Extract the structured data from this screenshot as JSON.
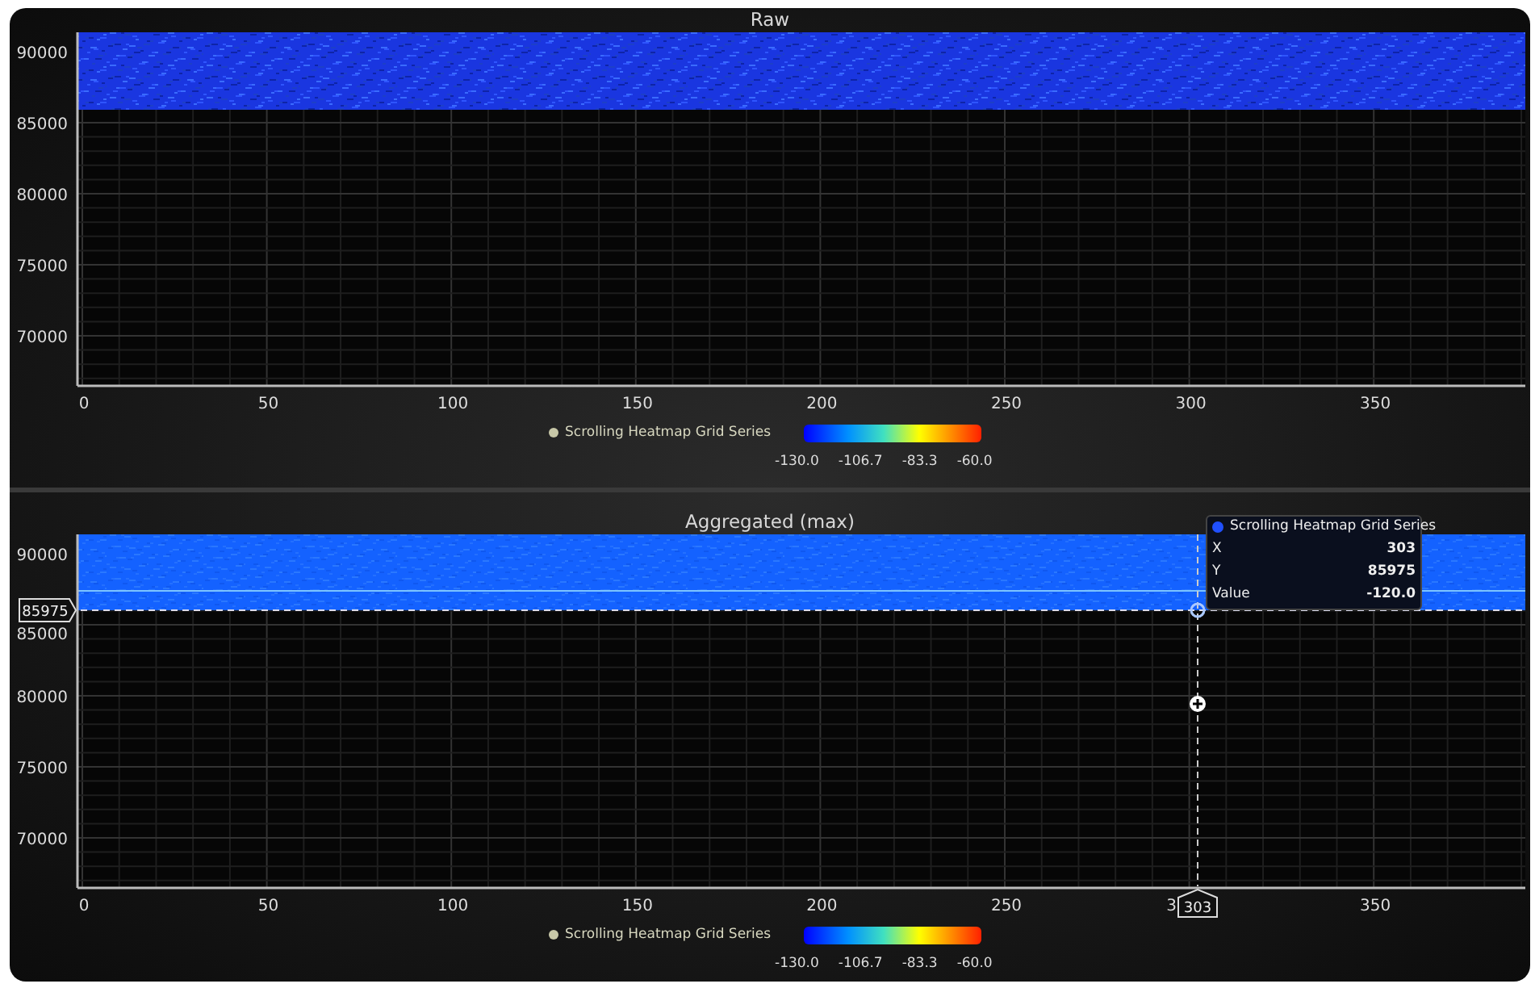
{
  "panels": [
    {
      "title": "Raw",
      "kind": "raw",
      "y_ticks": [
        "90000",
        "85000",
        "80000",
        "75000",
        "70000"
      ],
      "x_ticks": [
        "0",
        "50",
        "100",
        "150",
        "200",
        "250",
        "300",
        "350"
      ],
      "legend": {
        "label": "Scrolling Heatmap Grid Series"
      },
      "colorbar": {
        "labels": [
          "-130.0",
          "-106.7",
          "-83.3",
          "-60.0"
        ]
      }
    },
    {
      "title": "Aggregated (max)",
      "kind": "aggregated",
      "y_ticks": [
        "90000",
        "85000",
        "80000",
        "75000",
        "70000"
      ],
      "x_ticks": [
        "0",
        "50",
        "100",
        "150",
        "200",
        "250",
        "3",
        "350"
      ],
      "legend": {
        "label": "Scrolling Heatmap Grid Series"
      },
      "colorbar": {
        "labels": [
          "-130.0",
          "-106.7",
          "-83.3",
          "-60.0"
        ]
      },
      "crosshair": {
        "y_label": "85975",
        "x_label": "303",
        "tooltip": {
          "series": "Scrolling Heatmap Grid Series",
          "rows": [
            {
              "label": "X",
              "value": "303"
            },
            {
              "label": "Y",
              "value": "85975"
            },
            {
              "label": "Value",
              "value": "-120.0"
            }
          ]
        }
      }
    }
  ]
}
